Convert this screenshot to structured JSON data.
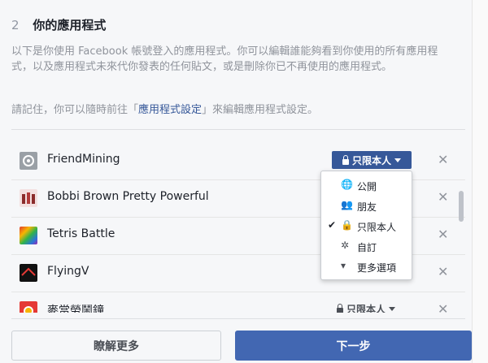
{
  "section": {
    "step_number": "2",
    "title": "你的應用程式",
    "description": "以下是你使用 Facebook 帳號登入的應用程式。你可以編輯誰能夠看到你使用的所有應用程式，以及應用程式未來代你發表的任何貼文，或是刪除你已不再使用的應用程式。",
    "note_prefix": "請記住，你可以隨時前往「",
    "note_link": "應用程式設定",
    "note_suffix": "」來編輯應用程式設定。"
  },
  "apps": [
    {
      "name": "FriendMining",
      "icon": "gear-icon",
      "privacy": "只限本人",
      "privacy_active": true
    },
    {
      "name": "Bobbi Brown Pretty Powerful",
      "icon": "bobbi-brown-icon",
      "privacy": ""
    },
    {
      "name": "Tetris Battle",
      "icon": "tetris-icon",
      "privacy": ""
    },
    {
      "name": "FlyingV",
      "icon": "flyingv-icon",
      "privacy": ""
    },
    {
      "name": "麥當勞鬧鐘",
      "icon": "mcdonalds-alarm-icon",
      "privacy": "只限本人"
    }
  ],
  "remove_symbol": "✕",
  "dropdown": {
    "items": [
      {
        "label": "公開",
        "icon": "globe-icon",
        "glyph": "🌐",
        "checked": false
      },
      {
        "label": "朋友",
        "icon": "friends-icon",
        "glyph": "👥",
        "checked": false
      },
      {
        "label": "只限本人",
        "icon": "lock-icon",
        "glyph": "🔒",
        "checked": true
      },
      {
        "label": "自訂",
        "icon": "gear-icon",
        "glyph": "✲",
        "checked": false
      },
      {
        "label": "更多選項",
        "icon": "caret-down-icon",
        "glyph": "▾",
        "checked": false
      }
    ],
    "check_glyph": "✔"
  },
  "buttons": {
    "learn_more": "瞭解更多",
    "next": "下一步"
  },
  "colors": {
    "accent": "#4267b2",
    "privacy_button": "#365899",
    "link": "#365899"
  }
}
